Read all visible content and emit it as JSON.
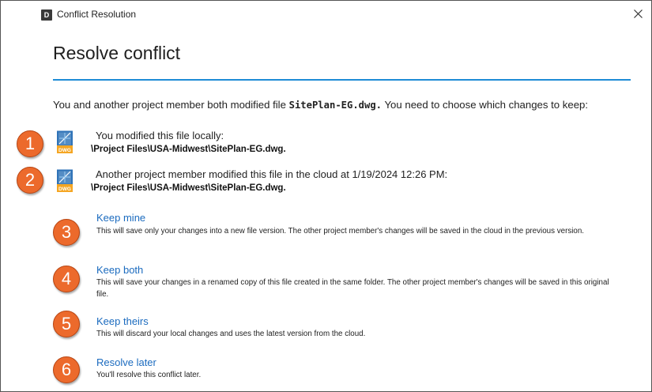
{
  "window": {
    "title": "Conflict Resolution",
    "icon_letter": "D",
    "close_glyph": "✕"
  },
  "heading": "Resolve conflict",
  "intro": {
    "before": "You and another project member both modified file ",
    "file_name": "SitePlan-EG.dwg.",
    "after": " You need to choose which changes to keep:"
  },
  "icon_label": "DWG",
  "local": {
    "badge": "1",
    "heading": "You modified this file locally:",
    "path": "\\Project Files\\USA-Midwest\\SitePlan-EG.dwg."
  },
  "cloud": {
    "badge": "2",
    "heading": "Another project member modified this file in the cloud at 1/19/2024 12:26 PM:",
    "path": "\\Project Files\\USA-Midwest\\SitePlan-EG.dwg."
  },
  "options": [
    {
      "badge": "3",
      "title": "Keep mine",
      "desc": "This will save only your changes into a new file version. The other project member's changes will be saved in the cloud in the previous version."
    },
    {
      "badge": "4",
      "title": "Keep both",
      "desc": "This will save your changes in a renamed copy of this file created in the same folder. The other project member's changes will be saved in this original file."
    },
    {
      "badge": "5",
      "title": "Keep theirs",
      "desc": "This will discard your local changes and uses the latest version from the cloud."
    },
    {
      "badge": "6",
      "title": "Resolve later",
      "desc": "You'll resolve this conflict later."
    }
  ],
  "colors": {
    "accent_line": "#1e8cd6",
    "link": "#1b6bbf",
    "badge": "#ec6a2c"
  }
}
